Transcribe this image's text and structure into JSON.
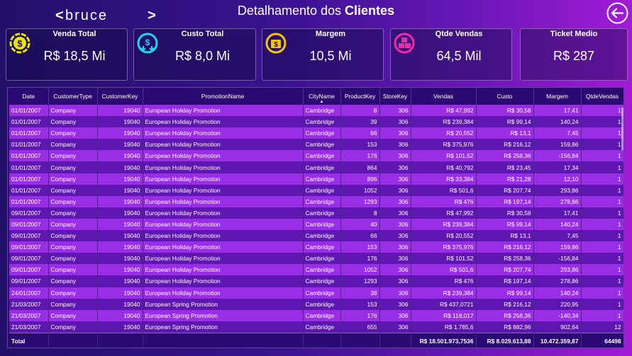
{
  "header": {
    "logo_text": "bruce",
    "title_prefix": "Detalhamento dos",
    "title_bold": "Clientes"
  },
  "colors": {
    "kpi_venda": "#e6e600",
    "kpi_custo": "#29d3f0",
    "kpi_margem": "#f0c800",
    "kpi_qtde": "#f02aa8",
    "row_light": "#9a2ee6",
    "row_dark": "#5e16b0"
  },
  "kpis": [
    {
      "label": "Venda Total",
      "value": "R$ 18,5 Mi",
      "icon": "dollar-coin-icon"
    },
    {
      "label": "Custo Total",
      "value": "R$ 8,0 Mi",
      "icon": "money-down-icon"
    },
    {
      "label": "Margem",
      "value": "10,5 Mi",
      "icon": "margin-icon"
    },
    {
      "label": "Qtde Vendas",
      "value": "64,5 Mil",
      "icon": "boxes-icon"
    },
    {
      "label": "Ticket Medio",
      "value": "R$ 287",
      "icon": ""
    }
  ],
  "table": {
    "columns": [
      "Date",
      "CustomerType",
      "CustomerKey",
      "PromotionName",
      "CityName",
      "ProductKey",
      "StoreKey",
      "Vendas",
      "Custo",
      "Margem",
      "QtdeVendas"
    ],
    "rows": [
      [
        "01/01/2007",
        "Company",
        "19040",
        "European Holiday Promotion",
        "Cambridge",
        "8",
        "306",
        "R$ 47,992",
        "R$ 30,58",
        "17,41",
        "1"
      ],
      [
        "01/01/2007",
        "Company",
        "19040",
        "European Holiday Promotion",
        "Cambridge",
        "39",
        "306",
        "R$ 239,384",
        "R$ 99,14",
        "140,24",
        "1"
      ],
      [
        "01/01/2007",
        "Company",
        "19040",
        "European Holiday Promotion",
        "Cambridge",
        "66",
        "306",
        "R$ 20,552",
        "R$ 13,1",
        "7,45",
        "1"
      ],
      [
        "01/01/2007",
        "Company",
        "19040",
        "European Holiday Promotion",
        "Cambridge",
        "153",
        "306",
        "R$ 375,976",
        "R$ 216,12",
        "159,86",
        "1"
      ],
      [
        "01/01/2007",
        "Company",
        "19040",
        "European Holiday Promotion",
        "Cambridge",
        "176",
        "306",
        "R$ 101,52",
        "R$ 258,36",
        "-156,84",
        "1"
      ],
      [
        "01/01/2007",
        "Company",
        "19040",
        "European Holiday Promotion",
        "Cambridge",
        "864",
        "306",
        "R$ 40,792",
        "R$ 23,45",
        "17,34",
        "1"
      ],
      [
        "01/01/2007",
        "Company",
        "19040",
        "European Holiday Promotion",
        "Cambridge",
        "896",
        "306",
        "R$ 33,384",
        "R$ 21,28",
        "12,10",
        "1"
      ],
      [
        "01/01/2007",
        "Company",
        "19040",
        "European Holiday Promotion",
        "Cambridge",
        "1052",
        "306",
        "R$ 501,6",
        "R$ 207,74",
        "293,86",
        "1"
      ],
      [
        "01/01/2007",
        "Company",
        "19040",
        "European Holiday Promotion",
        "Cambridge",
        "1293",
        "306",
        "R$ 476",
        "R$ 197,14",
        "278,86",
        "1"
      ],
      [
        "09/01/2007",
        "Company",
        "19040",
        "European Holiday Promotion",
        "Cambridge",
        "8",
        "306",
        "R$ 47,992",
        "R$ 30,58",
        "17,41",
        "1"
      ],
      [
        "09/01/2007",
        "Company",
        "19040",
        "European Holiday Promotion",
        "Cambridge",
        "40",
        "306",
        "R$ 239,384",
        "R$ 99,14",
        "140,24",
        "1"
      ],
      [
        "09/01/2007",
        "Company",
        "19040",
        "European Holiday Promotion",
        "Cambridge",
        "66",
        "306",
        "R$ 20,552",
        "R$ 13,1",
        "7,45",
        "1"
      ],
      [
        "09/01/2007",
        "Company",
        "19040",
        "European Holiday Promotion",
        "Cambridge",
        "153",
        "306",
        "R$ 375,976",
        "R$ 216,12",
        "159,86",
        "1"
      ],
      [
        "09/01/2007",
        "Company",
        "19040",
        "European Holiday Promotion",
        "Cambridge",
        "176",
        "306",
        "R$ 101,52",
        "R$ 258,36",
        "-156,84",
        "1"
      ],
      [
        "09/01/2007",
        "Company",
        "19040",
        "European Holiday Promotion",
        "Cambridge",
        "1052",
        "306",
        "R$ 501,6",
        "R$ 207,74",
        "293,86",
        "1"
      ],
      [
        "09/01/2007",
        "Company",
        "19040",
        "European Holiday Promotion",
        "Cambridge",
        "1293",
        "306",
        "R$ 476",
        "R$ 197,14",
        "278,86",
        "1"
      ],
      [
        "24/01/2007",
        "Company",
        "19040",
        "European Holiday Promotion",
        "Cambridge",
        "38",
        "306",
        "R$ 239,384",
        "R$ 99,14",
        "140,24",
        "1"
      ],
      [
        "21/03/2007",
        "Company",
        "19040",
        "European Spring Promotion",
        "Cambridge",
        "153",
        "306",
        "R$ 437,0721",
        "R$ 216,12",
        "220,95",
        "1"
      ],
      [
        "21/03/2007",
        "Company",
        "19040",
        "European Spring Promotion",
        "Cambridge",
        "176",
        "306",
        "R$ 118,017",
        "R$ 258,36",
        "-140,34",
        "1"
      ],
      [
        "21/03/2007",
        "Company",
        "19040",
        "European Spring Promotion",
        "Cambridge",
        "655",
        "306",
        "R$ 1.785,6",
        "R$ 882,96",
        "902,64",
        "12"
      ]
    ],
    "total": [
      "Total",
      "",
      "",
      "",
      "",
      "",
      "",
      "R$ 18.501.973,7536",
      "R$ 8.029.613,88",
      "10.472.359,87",
      "64498"
    ]
  }
}
